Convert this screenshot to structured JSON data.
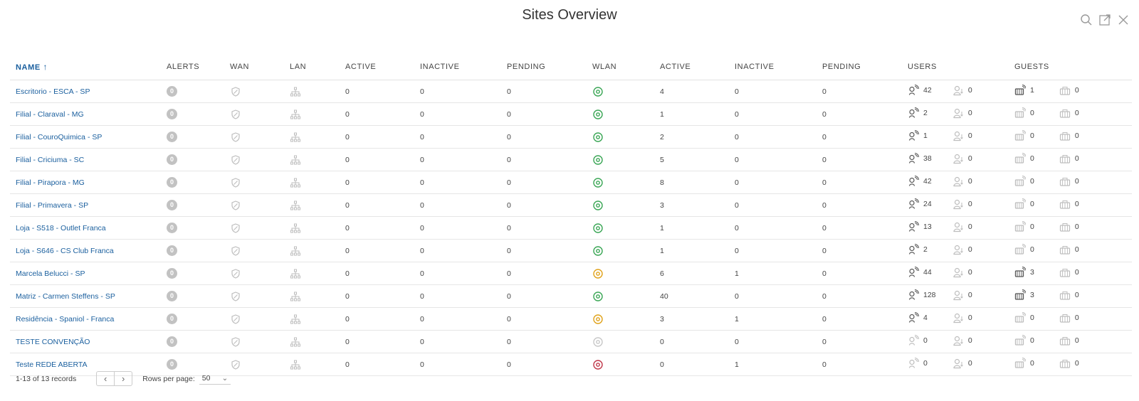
{
  "title": "Sites Overview",
  "header_icons": [
    "search-icon",
    "popout-icon",
    "close-icon"
  ],
  "columns": {
    "name": "NAME",
    "alerts": "ALERTS",
    "wan": "WAN",
    "lan": "LAN",
    "lan_active": "ACTIVE",
    "lan_inactive": "INACTIVE",
    "lan_pending": "PENDING",
    "wlan": "WLAN",
    "wlan_active": "ACTIVE",
    "wlan_inactive": "INACTIVE",
    "wlan_pending": "PENDING",
    "users": "USERS",
    "guests": "GUESTS"
  },
  "sort_indicator": "↑",
  "colors": {
    "link": "#1a5f9e",
    "wlan_ok": "#3aa655",
    "wlan_warn": "#e0a21a",
    "wlan_off": "#c8c8c8",
    "wlan_err": "#c0394b"
  },
  "rows": [
    {
      "name": "Escritorio - ESCA - SP",
      "alerts": "0",
      "lan_active": "0",
      "lan_inactive": "0",
      "lan_pending": "0",
      "wlan_status": "ok",
      "wlan_active": "4",
      "wlan_inactive": "0",
      "wlan_pending": "0",
      "users_wireless": "42",
      "users_wired": "0",
      "guests_wireless": "1",
      "guests_wired": "0",
      "users_active": true,
      "guests_active": true
    },
    {
      "name": "Filial - Claraval - MG",
      "alerts": "0",
      "lan_active": "0",
      "lan_inactive": "0",
      "lan_pending": "0",
      "wlan_status": "ok",
      "wlan_active": "1",
      "wlan_inactive": "0",
      "wlan_pending": "0",
      "users_wireless": "2",
      "users_wired": "0",
      "guests_wireless": "0",
      "guests_wired": "0",
      "users_active": true,
      "guests_active": false
    },
    {
      "name": "Filial - CouroQuimica - SP",
      "alerts": "0",
      "lan_active": "0",
      "lan_inactive": "0",
      "lan_pending": "0",
      "wlan_status": "ok",
      "wlan_active": "2",
      "wlan_inactive": "0",
      "wlan_pending": "0",
      "users_wireless": "1",
      "users_wired": "0",
      "guests_wireless": "0",
      "guests_wired": "0",
      "users_active": true,
      "guests_active": false
    },
    {
      "name": "Filial - Criciuma - SC",
      "alerts": "0",
      "lan_active": "0",
      "lan_inactive": "0",
      "lan_pending": "0",
      "wlan_status": "ok",
      "wlan_active": "5",
      "wlan_inactive": "0",
      "wlan_pending": "0",
      "users_wireless": "38",
      "users_wired": "0",
      "guests_wireless": "0",
      "guests_wired": "0",
      "users_active": true,
      "guests_active": false
    },
    {
      "name": "Filial - Pirapora - MG",
      "alerts": "0",
      "lan_active": "0",
      "lan_inactive": "0",
      "lan_pending": "0",
      "wlan_status": "ok",
      "wlan_active": "8",
      "wlan_inactive": "0",
      "wlan_pending": "0",
      "users_wireless": "42",
      "users_wired": "0",
      "guests_wireless": "0",
      "guests_wired": "0",
      "users_active": true,
      "guests_active": false
    },
    {
      "name": "Filial - Primavera - SP",
      "alerts": "0",
      "lan_active": "0",
      "lan_inactive": "0",
      "lan_pending": "0",
      "wlan_status": "ok",
      "wlan_active": "3",
      "wlan_inactive": "0",
      "wlan_pending": "0",
      "users_wireless": "24",
      "users_wired": "0",
      "guests_wireless": "0",
      "guests_wired": "0",
      "users_active": true,
      "guests_active": false
    },
    {
      "name": "Loja - S518 - Outlet Franca",
      "alerts": "0",
      "lan_active": "0",
      "lan_inactive": "0",
      "lan_pending": "0",
      "wlan_status": "ok",
      "wlan_active": "1",
      "wlan_inactive": "0",
      "wlan_pending": "0",
      "users_wireless": "13",
      "users_wired": "0",
      "guests_wireless": "0",
      "guests_wired": "0",
      "users_active": true,
      "guests_active": false
    },
    {
      "name": "Loja - S646 - CS Club Franca",
      "alerts": "0",
      "lan_active": "0",
      "lan_inactive": "0",
      "lan_pending": "0",
      "wlan_status": "ok",
      "wlan_active": "1",
      "wlan_inactive": "0",
      "wlan_pending": "0",
      "users_wireless": "2",
      "users_wired": "0",
      "guests_wireless": "0",
      "guests_wired": "0",
      "users_active": true,
      "guests_active": false
    },
    {
      "name": "Marcela Belucci - SP",
      "alerts": "0",
      "lan_active": "0",
      "lan_inactive": "0",
      "lan_pending": "0",
      "wlan_status": "warn",
      "wlan_active": "6",
      "wlan_inactive": "1",
      "wlan_pending": "0",
      "users_wireless": "44",
      "users_wired": "0",
      "guests_wireless": "3",
      "guests_wired": "0",
      "users_active": true,
      "guests_active": true
    },
    {
      "name": "Matriz - Carmen Steffens - SP",
      "alerts": "0",
      "lan_active": "0",
      "lan_inactive": "0",
      "lan_pending": "0",
      "wlan_status": "ok",
      "wlan_active": "40",
      "wlan_inactive": "0",
      "wlan_pending": "0",
      "users_wireless": "128",
      "users_wired": "0",
      "guests_wireless": "3",
      "guests_wired": "0",
      "users_active": true,
      "guests_active": true
    },
    {
      "name": "Residência - Spaniol - Franca",
      "alerts": "0",
      "lan_active": "0",
      "lan_inactive": "0",
      "lan_pending": "0",
      "wlan_status": "warn",
      "wlan_active": "3",
      "wlan_inactive": "1",
      "wlan_pending": "0",
      "users_wireless": "4",
      "users_wired": "0",
      "guests_wireless": "0",
      "guests_wired": "0",
      "users_active": true,
      "guests_active": false
    },
    {
      "name": "TESTE CONVENÇÃO",
      "alerts": "0",
      "lan_active": "0",
      "lan_inactive": "0",
      "lan_pending": "0",
      "wlan_status": "off",
      "wlan_active": "0",
      "wlan_inactive": "0",
      "wlan_pending": "0",
      "users_wireless": "0",
      "users_wired": "0",
      "guests_wireless": "0",
      "guests_wired": "0",
      "users_active": false,
      "guests_active": false
    },
    {
      "name": "Teste REDE ABERTA",
      "alerts": "0",
      "lan_active": "0",
      "lan_inactive": "0",
      "lan_pending": "0",
      "wlan_status": "err",
      "wlan_active": "0",
      "wlan_inactive": "1",
      "wlan_pending": "0",
      "users_wireless": "0",
      "users_wired": "0",
      "guests_wireless": "0",
      "guests_wired": "0",
      "users_active": false,
      "guests_active": false
    }
  ],
  "footer": {
    "records": "1-13 of 13 records",
    "prev": "‹",
    "next": "›",
    "rows_per_page_label": "Rows per page:",
    "rows_per_page_value": "50",
    "dropdown_glyph": "⌄"
  }
}
